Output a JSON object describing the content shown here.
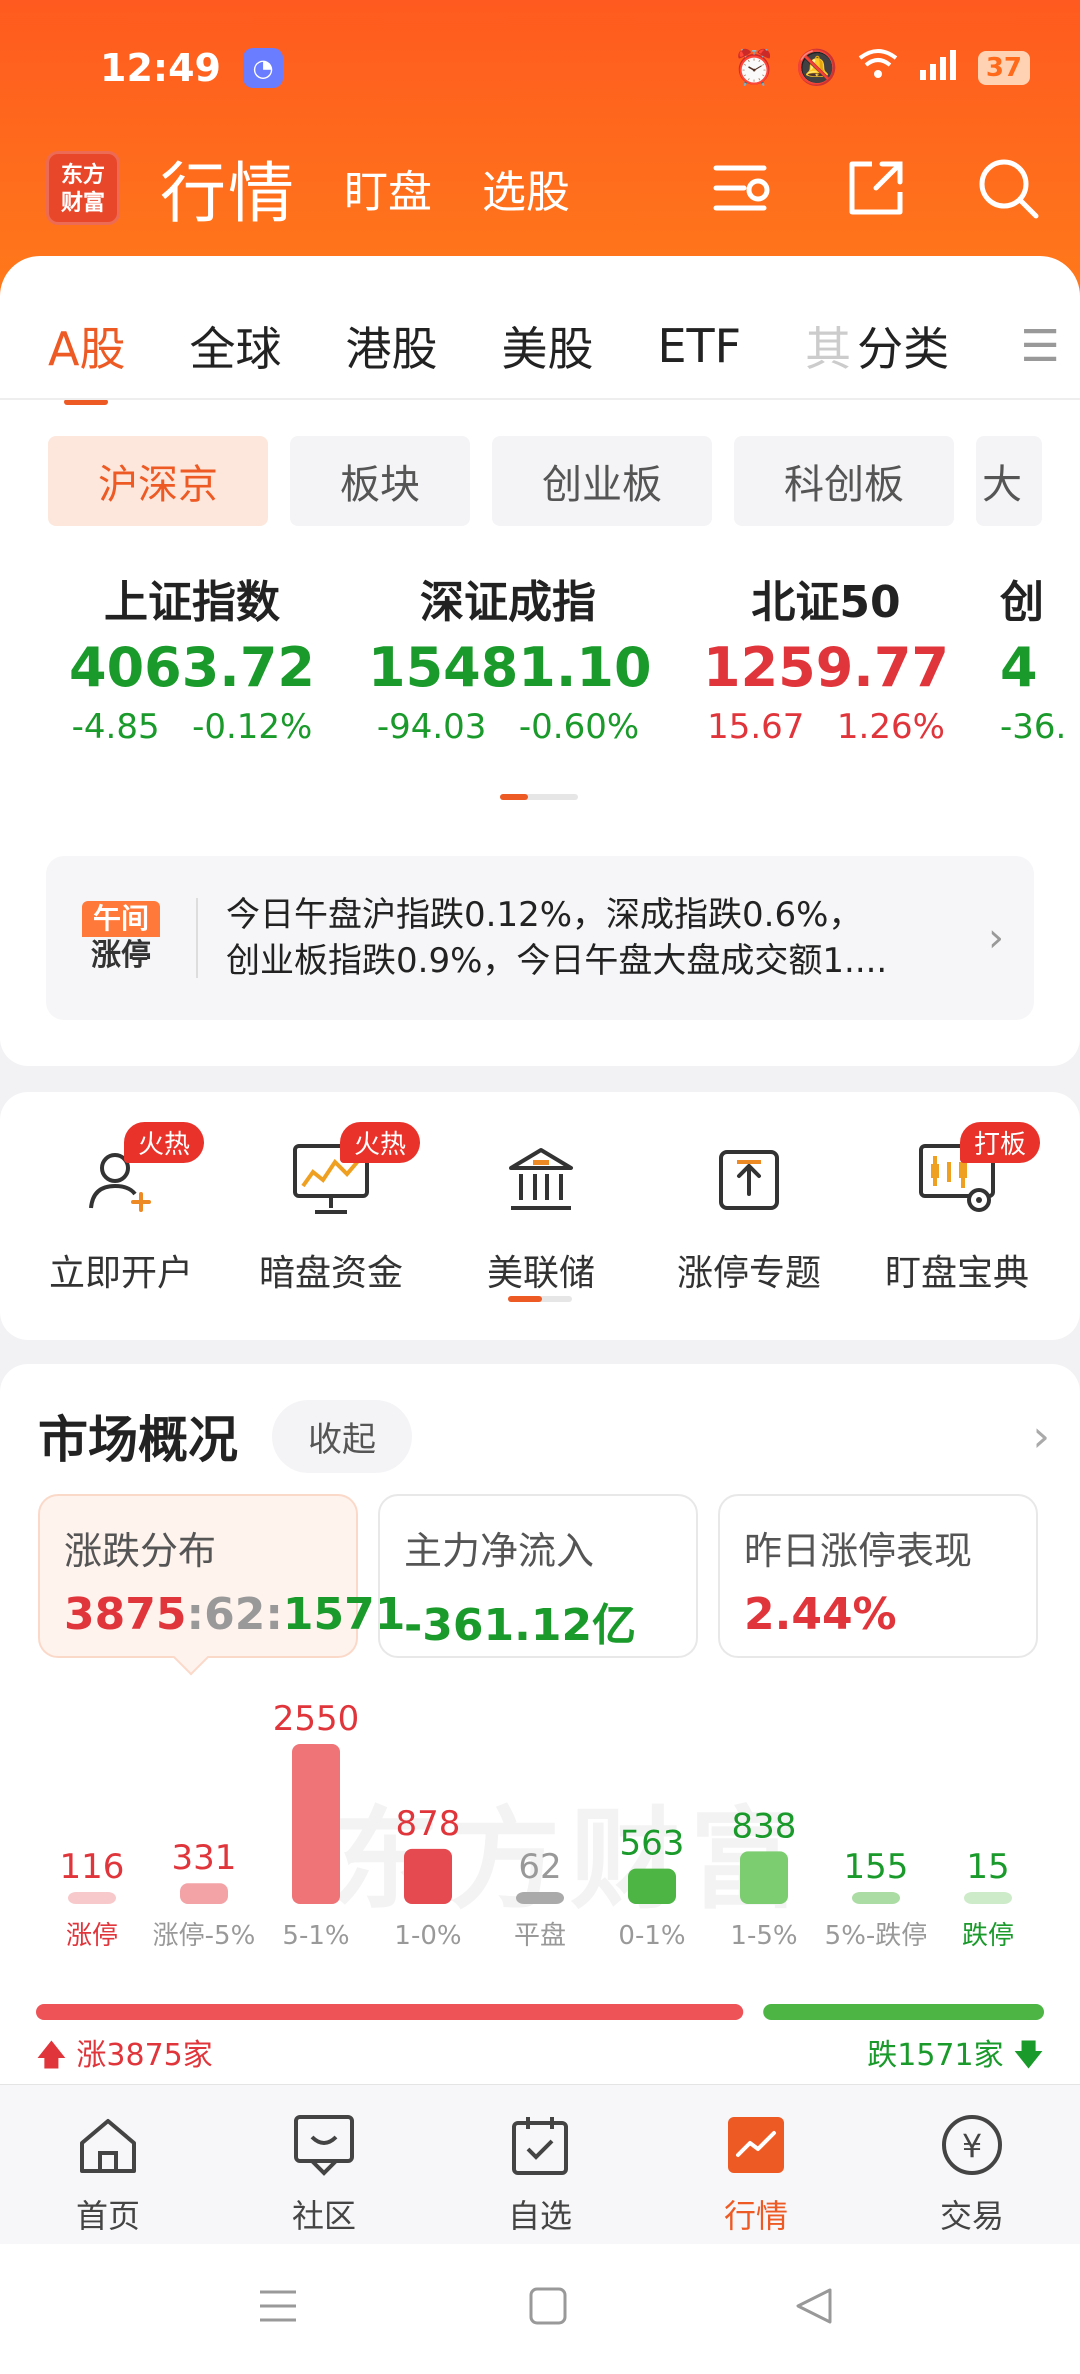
{
  "status": {
    "time": "12:49",
    "battery": "37"
  },
  "header": {
    "logo_line1": "东方",
    "logo_line2": "财富",
    "title": "行情",
    "tab_watch": "盯盘",
    "tab_pick": "选股"
  },
  "tabs": {
    "a": "A股",
    "global": "全球",
    "hk": "港股",
    "us": "美股",
    "etf": "ETF",
    "fade": "其",
    "category": "分类"
  },
  "chips": [
    "沪深京",
    "板块",
    "创业板",
    "科创板",
    "大"
  ],
  "indices": [
    {
      "name": "上证指数",
      "value": "4063.72",
      "change": "-4.85",
      "pct": "-0.12%",
      "color": "green"
    },
    {
      "name": "深证成指",
      "value": "15481.10",
      "change": "-94.03",
      "pct": "-0.60%",
      "color": "green"
    },
    {
      "name": "北证50",
      "value": "1259.77",
      "change": "15.67",
      "pct": "1.26%",
      "color": "red"
    },
    {
      "name": "创",
      "value": "4",
      "change": "-36.",
      "pct": "",
      "color": "green"
    }
  ],
  "news": {
    "logo_top": "午间",
    "logo_bottom": "涨停",
    "line1": "今日午盘沪指跌0.12%，深成指跌0.6%，",
    "line2": "创业板指跌0.9%，今日午盘大盘成交额1...."
  },
  "quick": [
    {
      "label": "立即开户",
      "badge": "火热"
    },
    {
      "label": "暗盘资金",
      "badge": "火热"
    },
    {
      "label": "美联储",
      "badge": ""
    },
    {
      "label": "涨停专题",
      "badge": ""
    },
    {
      "label": "盯盘宝典",
      "badge": "打板"
    }
  ],
  "market": {
    "title": "市场概况",
    "collapse": "收起",
    "dist": {
      "label": "涨跌分布",
      "up": "3875",
      "sep1": ":",
      "flat": "62",
      "sep2": ":",
      "down": "1571"
    },
    "flow": {
      "label": "主力净流入",
      "value": "-361.12亿"
    },
    "yday": {
      "label": "昨日涨停表现",
      "value": "2.44%"
    },
    "watermark": "东方财富",
    "up_label": "涨3875家",
    "down_label": "跌1571家"
  },
  "chart_data": {
    "type": "bar",
    "categories": [
      "涨停",
      "涨停-5%",
      "5-1%",
      "1-0%",
      "平盘",
      "0-1%",
      "1-5%",
      "5%-跌停",
      "跌停"
    ],
    "values": [
      116,
      331,
      2550,
      878,
      62,
      563,
      838,
      155,
      15
    ],
    "colors": [
      "#f8c9cb",
      "#f3a2a6",
      "#ee7478",
      "#e44a50",
      "#aaaaaa",
      "#4cb544",
      "#7ccc70",
      "#abdca3",
      "#cdebc8"
    ],
    "label_colors": [
      "#e0353b",
      "#e0353b",
      "#e0353b",
      "#e0353b",
      "#999999",
      "#1a9a2a",
      "#1a9a2a",
      "#1a9a2a",
      "#1a9a2a"
    ],
    "up_total": 3875,
    "down_total": 1571
  },
  "nav": [
    {
      "label": "首页",
      "icon": "home-icon"
    },
    {
      "label": "社区",
      "icon": "community-icon"
    },
    {
      "label": "自选",
      "icon": "watchlist-icon"
    },
    {
      "label": "行情",
      "icon": "market-icon"
    },
    {
      "label": "交易",
      "icon": "trade-icon"
    }
  ],
  "colors": {
    "accent": "#ee5a24",
    "up": "#e0353b",
    "down": "#1a9a2a"
  }
}
